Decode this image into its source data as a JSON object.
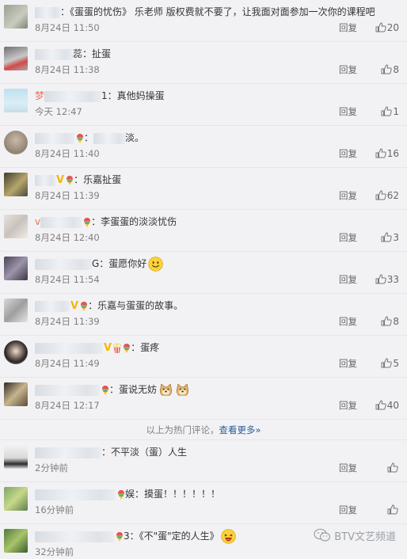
{
  "hot_comments": [
    {
      "name": "",
      "text": "：《蛋蛋的忧伤》  乐老师 版权费就不要了，让我面对面参加一次你的课程吧",
      "time": "8月24日 11:50",
      "likes": "20"
    },
    {
      "name": "",
      "text": "蕊：扯蛋",
      "time": "8月24日 11:38",
      "likes": "8"
    },
    {
      "name": "梦",
      "text": "1：真他妈操蛋",
      "time": "今天 12:47",
      "likes": "1"
    },
    {
      "name": "",
      "text": "：",
      "text2": "淡。",
      "time": "8月24日 11:40",
      "likes": "16"
    },
    {
      "name": "",
      "text": "：乐嘉扯蛋",
      "time": "8月24日 11:39",
      "likes": "62"
    },
    {
      "name": "v",
      "text": "：李蛋蛋的淡淡忧伤",
      "time": "8月24日 12:40",
      "likes": "3"
    },
    {
      "name": "",
      "text": "G：蛋愿你好",
      "time": "8月24日 11:54",
      "likes": "33"
    },
    {
      "name": "",
      "text": "：乐嘉与蛋蛋的故事。",
      "time": "8月24日 11:39",
      "likes": "8"
    },
    {
      "name": "",
      "text": "：蛋疼",
      "time": "8月24日 11:49",
      "likes": "5"
    },
    {
      "name": "",
      "text": "：蛋说无妨",
      "time": "8月24日 12:17",
      "likes": "40"
    }
  ],
  "hot_footer": {
    "prefix": "以上为热门评论，",
    "more": "查看更多»"
  },
  "recent_comments": [
    {
      "name": "",
      "text": "：不平淡（蛋）人生",
      "time": "2分钟前",
      "likes": ""
    },
    {
      "name": "",
      "text": "娱：摸蛋！！！！！！",
      "time": "16分钟前",
      "likes": ""
    },
    {
      "name": "",
      "text": "3：《不\"蛋\"定的人生》",
      "time": "32分钟前",
      "likes": ""
    }
  ],
  "labels": {
    "reply": "回复"
  },
  "watermark": "BTV文艺频道",
  "colors": {
    "name": "#eb7350",
    "link": "#2c5c98",
    "meta": "#808080",
    "bg": "#f2f2f5"
  },
  "icons": [
    "thumb-up-icon",
    "rainbow-badge-icon",
    "vip-v-icon",
    "smile-emoji-icon",
    "doge-emoji-icon",
    "laugh-emoji-icon",
    "wechat-icon"
  ]
}
